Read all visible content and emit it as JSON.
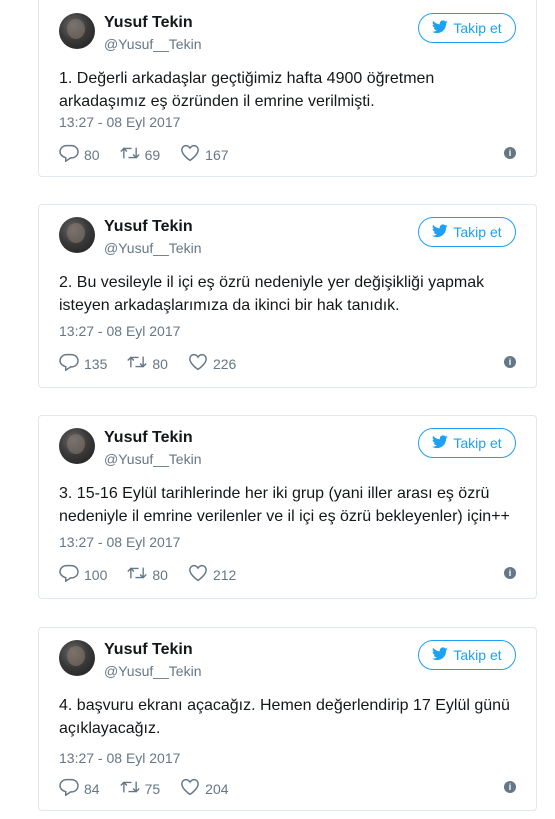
{
  "tweets": [
    {
      "name": "Yusuf Tekin",
      "handle": "@Yusuf__Tekin",
      "follow_label": "Takip et",
      "text": "1. Değerli arkadaşlar geçtiğimiz hafta 4900 öğretmen arkadaşımız eş özründen il emrine verilmişti.",
      "time": "13:27 - 08 Eyl 2017",
      "replies": "80",
      "retweets": "69",
      "likes": "167"
    },
    {
      "name": "Yusuf Tekin",
      "handle": "@Yusuf__Tekin",
      "follow_label": "Takip et",
      "text": "2. Bu vesileyle il içi eş özrü nedeniyle yer değişikliği yapmak isteyen arkadaşlarımıza da ikinci bir hak tanıdık.",
      "time": "13:27 - 08 Eyl 2017",
      "replies": "135",
      "retweets": "80",
      "likes": "226"
    },
    {
      "name": "Yusuf Tekin",
      "handle": "@Yusuf__Tekin",
      "follow_label": "Takip et",
      "text": "3. 15-16 Eylül tarihlerinde her iki grup (yani iller arası eş özrü nedeniyle il emrine verilenler ve il içi eş özrü bekleyenler) için++",
      "time": "13:27 - 08 Eyl 2017",
      "replies": "100",
      "retweets": "80",
      "likes": "212"
    },
    {
      "name": "Yusuf Tekin",
      "handle": "@Yusuf__Tekin",
      "follow_label": "Takip et",
      "text": "4. başvuru ekranı açacağız. Hemen değerlendirip 17 Eylül günü açıklayacağız.",
      "time": "13:27 - 08 Eyl 2017",
      "replies": "84",
      "retweets": "75",
      "likes": "204"
    }
  ],
  "icons": {
    "follow": "twitter-bird-icon",
    "reply": "reply-icon",
    "retweet": "retweet-icon",
    "like": "heart-icon",
    "info": "info-icon"
  },
  "colors": {
    "accent": "#1da1f2",
    "muted": "#657786",
    "text": "#14171a",
    "border": "#e1e8ed"
  }
}
